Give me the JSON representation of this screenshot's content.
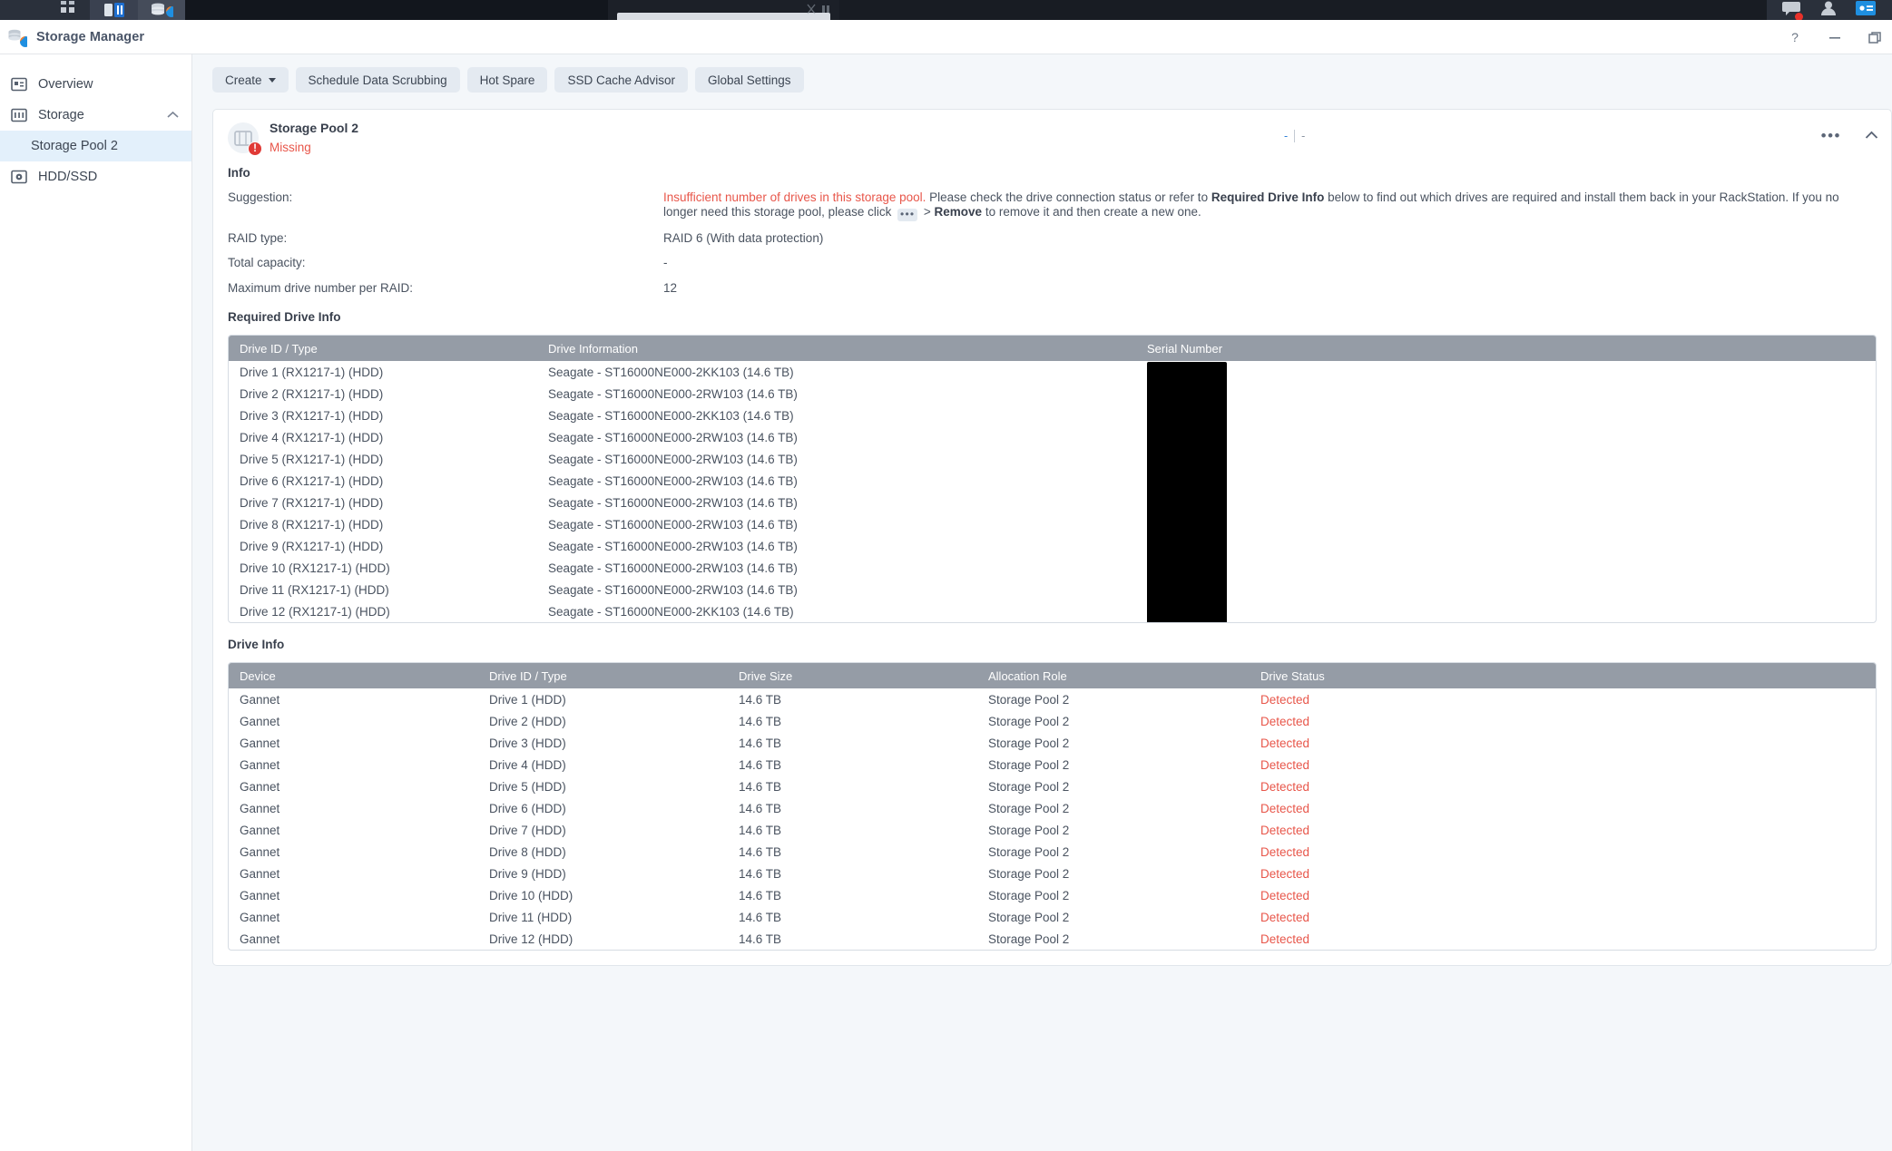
{
  "taskbar": {
    "icons": [
      "apps-grid-icon",
      "package-center-icon",
      "storage-manager-icon",
      "chat-notification-icon",
      "user-account-icon",
      "notification-card-icon"
    ]
  },
  "window": {
    "title": "Storage Manager",
    "app_icon": "storage-manager-icon",
    "controls": [
      {
        "name": "help-button",
        "glyph": "?"
      },
      {
        "name": "minimize-button",
        "glyph": "—"
      },
      {
        "name": "restore-button",
        "glyph": "❐"
      }
    ]
  },
  "sidebar": {
    "items": [
      {
        "label": "Overview",
        "icon": "overview-icon",
        "selected": false
      },
      {
        "label": "Storage",
        "icon": "storage-icon",
        "selected": false,
        "expanded": true,
        "chevron": "chevron-up-icon"
      },
      {
        "label": "Storage Pool 2",
        "icon": "",
        "selected": true,
        "sub": true
      },
      {
        "label": "HDD/SSD",
        "icon": "hdd-ssd-icon",
        "selected": false
      }
    ]
  },
  "toolbar": {
    "create_label": "Create",
    "buttons": [
      "Schedule Data Scrubbing",
      "Hot Spare",
      "SSD Cache Advisor",
      "Global Settings"
    ]
  },
  "pool": {
    "name": "Storage Pool 2",
    "status": "Missing",
    "status_badge": "!",
    "usage_used": "-",
    "usage_total": "-",
    "menu_glyph": "•••",
    "collapse_icon": "chevron-up-icon"
  },
  "info": {
    "title": "Info",
    "suggestion_label": "Suggestion:",
    "suggestion_warn": "Insufficient number of drives in this storage pool.",
    "suggestion_part1": " Please check the drive connection status or refer to ",
    "suggestion_bold1": "Required Drive Info",
    "suggestion_part2": " below to find out which drives are required and install them back in your RackStation. If you no longer need this storage pool, please click ",
    "suggestion_dots": "•••",
    "suggestion_part3": " > ",
    "suggestion_bold2": "Remove",
    "suggestion_part4": " to remove it and then create a new one.",
    "raid_type_label": "RAID type:",
    "raid_type_value": "RAID 6 (With data protection)",
    "total_capacity_label": "Total capacity:",
    "total_capacity_value": "-",
    "max_drive_label": "Maximum drive number per RAID:",
    "max_drive_value": "12"
  },
  "required_drive_info": {
    "title": "Required Drive Info",
    "columns": [
      "Drive ID / Type",
      "Drive Information",
      "Serial Number"
    ],
    "rows": [
      {
        "id": "Drive 1 (RX1217-1) (HDD)",
        "info": "Seagate - ST16000NE000-2KK103 (14.6 TB)",
        "serial": ""
      },
      {
        "id": "Drive 2 (RX1217-1) (HDD)",
        "info": "Seagate - ST16000NE000-2RW103 (14.6 TB)",
        "serial": ""
      },
      {
        "id": "Drive 3 (RX1217-1) (HDD)",
        "info": "Seagate - ST16000NE000-2KK103 (14.6 TB)",
        "serial": ""
      },
      {
        "id": "Drive 4 (RX1217-1) (HDD)",
        "info": "Seagate - ST16000NE000-2RW103 (14.6 TB)",
        "serial": ""
      },
      {
        "id": "Drive 5 (RX1217-1) (HDD)",
        "info": "Seagate - ST16000NE000-2RW103 (14.6 TB)",
        "serial": ""
      },
      {
        "id": "Drive 6 (RX1217-1) (HDD)",
        "info": "Seagate - ST16000NE000-2RW103 (14.6 TB)",
        "serial": ""
      },
      {
        "id": "Drive 7 (RX1217-1) (HDD)",
        "info": "Seagate - ST16000NE000-2RW103 (14.6 TB)",
        "serial": ""
      },
      {
        "id": "Drive 8 (RX1217-1) (HDD)",
        "info": "Seagate - ST16000NE000-2RW103 (14.6 TB)",
        "serial": ""
      },
      {
        "id": "Drive 9 (RX1217-1) (HDD)",
        "info": "Seagate - ST16000NE000-2RW103 (14.6 TB)",
        "serial": ""
      },
      {
        "id": "Drive 10 (RX1217-1) (HDD)",
        "info": "Seagate - ST16000NE000-2RW103 (14.6 TB)",
        "serial": ""
      },
      {
        "id": "Drive 11 (RX1217-1) (HDD)",
        "info": "Seagate - ST16000NE000-2RW103 (14.6 TB)",
        "serial": ""
      },
      {
        "id": "Drive 12 (RX1217-1) (HDD)",
        "info": "Seagate - ST16000NE000-2KK103 (14.6 TB)",
        "serial": ""
      }
    ]
  },
  "drive_info": {
    "title": "Drive Info",
    "columns": [
      "Device",
      "Drive ID / Type",
      "Drive Size",
      "Allocation Role",
      "Drive Status"
    ],
    "rows": [
      {
        "device": "Gannet",
        "id": "Drive 1 (HDD)",
        "size": "14.6 TB",
        "role": "Storage Pool 2",
        "status": "Detected"
      },
      {
        "device": "Gannet",
        "id": "Drive 2 (HDD)",
        "size": "14.6 TB",
        "role": "Storage Pool 2",
        "status": "Detected"
      },
      {
        "device": "Gannet",
        "id": "Drive 3 (HDD)",
        "size": "14.6 TB",
        "role": "Storage Pool 2",
        "status": "Detected"
      },
      {
        "device": "Gannet",
        "id": "Drive 4 (HDD)",
        "size": "14.6 TB",
        "role": "Storage Pool 2",
        "status": "Detected"
      },
      {
        "device": "Gannet",
        "id": "Drive 5 (HDD)",
        "size": "14.6 TB",
        "role": "Storage Pool 2",
        "status": "Detected"
      },
      {
        "device": "Gannet",
        "id": "Drive 6 (HDD)",
        "size": "14.6 TB",
        "role": "Storage Pool 2",
        "status": "Detected"
      },
      {
        "device": "Gannet",
        "id": "Drive 7 (HDD)",
        "size": "14.6 TB",
        "role": "Storage Pool 2",
        "status": "Detected"
      },
      {
        "device": "Gannet",
        "id": "Drive 8 (HDD)",
        "size": "14.6 TB",
        "role": "Storage Pool 2",
        "status": "Detected"
      },
      {
        "device": "Gannet",
        "id": "Drive 9 (HDD)",
        "size": "14.6 TB",
        "role": "Storage Pool 2",
        "status": "Detected"
      },
      {
        "device": "Gannet",
        "id": "Drive 10 (HDD)",
        "size": "14.6 TB",
        "role": "Storage Pool 2",
        "status": "Detected"
      },
      {
        "device": "Gannet",
        "id": "Drive 11 (HDD)",
        "size": "14.6 TB",
        "role": "Storage Pool 2",
        "status": "Detected"
      },
      {
        "device": "Gannet",
        "id": "Drive 12 (HDD)",
        "size": "14.6 TB",
        "role": "Storage Pool 2",
        "status": "Detected"
      }
    ]
  },
  "colors": {
    "accent": "#2f7fd6",
    "error": "#e8564a",
    "header_gray": "#959ca6",
    "panel_bg": "#f4f7fa",
    "selected_nav": "#e3f0fb"
  }
}
